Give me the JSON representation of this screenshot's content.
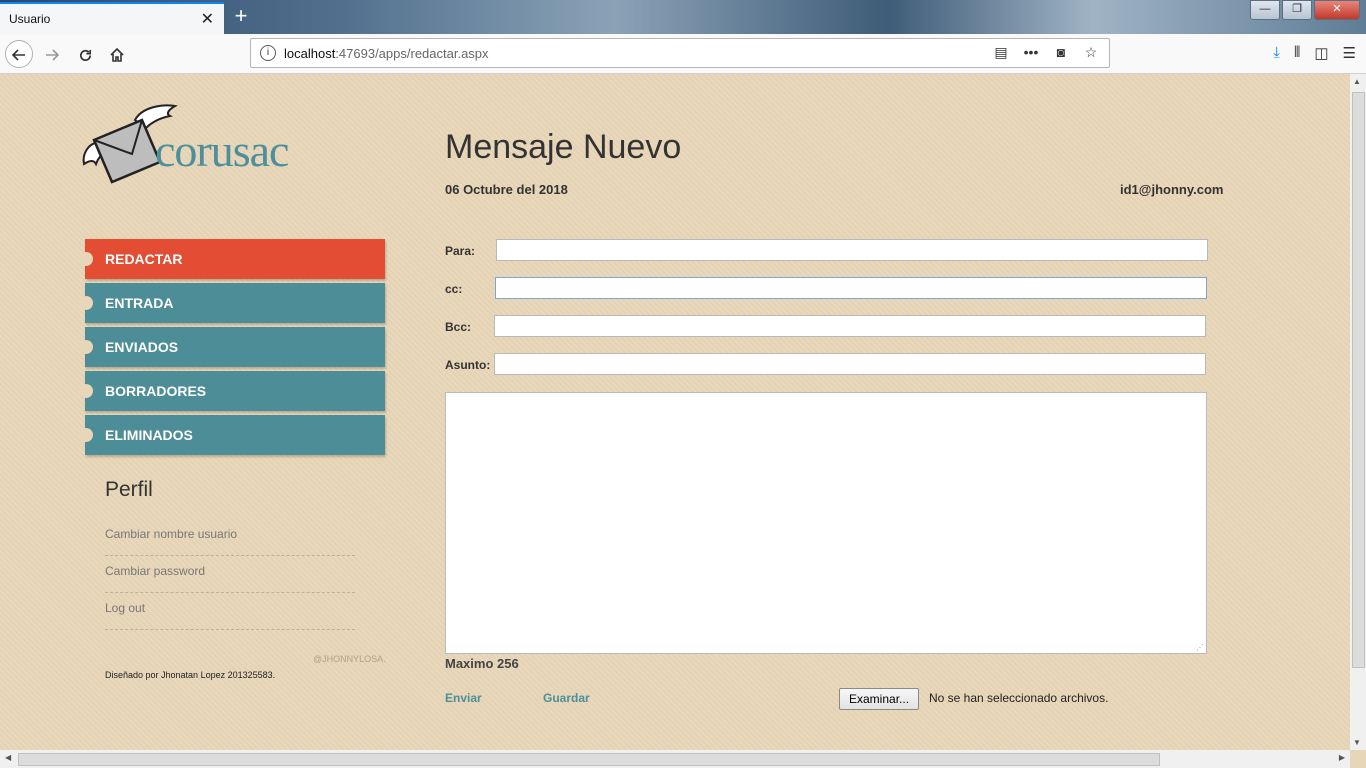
{
  "browser": {
    "tab_title": "Usuario",
    "tab_close": "✕",
    "new_tab": "+",
    "url_host": "localhost",
    "url_rest": ":47693/apps/redactar.aspx",
    "window_buttons": [
      "—",
      "❐",
      "✕"
    ]
  },
  "site": {
    "logo_text": "corusac",
    "menu": [
      {
        "label": "REDACTAR",
        "active": true
      },
      {
        "label": "ENTRADA",
        "active": false
      },
      {
        "label": "ENVIADOS",
        "active": false
      },
      {
        "label": "BORRADORES",
        "active": false
      },
      {
        "label": "ELIMINADOS",
        "active": false
      }
    ],
    "perfil_title": "Perfil",
    "perfil_links": [
      "Cambiar nombre usuario",
      "Cambiar password",
      "Log out"
    ],
    "handle": "@JHONNYLOSA.",
    "credit": "Diseñado por Jhonatan Lopez 201325583."
  },
  "compose": {
    "heading": "Mensaje Nuevo",
    "date": "06 Octubre del 2018",
    "user_email": "id1@jhonny.com",
    "fields": [
      {
        "label": "Para:",
        "value": ""
      },
      {
        "label": "cc:",
        "value": ""
      },
      {
        "label": "Bcc:",
        "value": ""
      },
      {
        "label": "Asunto:",
        "value": ""
      }
    ],
    "body_value": "",
    "max_note": "Maximo 256",
    "send_label": "Enviar",
    "save_label": "Guardar",
    "browse_label": "Examinar...",
    "no_file_text": "No se han seleccionado archivos."
  },
  "colors": {
    "page_bg": "#e8d6b8",
    "menu_teal": "#4d8d97",
    "menu_active": "#e24d33",
    "logo_teal": "#4d8f9b"
  }
}
